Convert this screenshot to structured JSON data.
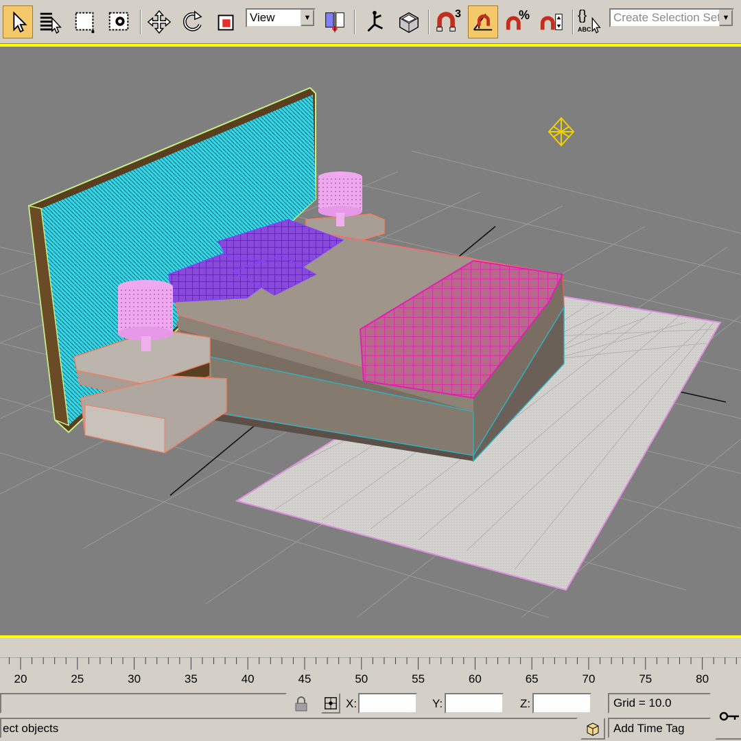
{
  "toolbar": {
    "tools": [
      {
        "name": "select-object-icon",
        "active": true
      },
      {
        "name": "select-by-name-icon",
        "active": false
      },
      {
        "name": "rectangular-selection-icon",
        "active": false
      },
      {
        "name": "window-crossing-icon",
        "active": false
      },
      {
        "name": "move-icon",
        "active": false
      },
      {
        "name": "rotate-icon",
        "active": false
      },
      {
        "name": "scale-icon",
        "active": false
      },
      {
        "name": "pivot-center-icon",
        "active": false
      },
      {
        "name": "select-and-manipulate-icon",
        "active": false
      },
      {
        "name": "keyboard-shortcut-override-icon",
        "active": false
      },
      {
        "name": "snaps-toggle-icon",
        "active": false
      },
      {
        "name": "angle-snap-icon",
        "active": true
      },
      {
        "name": "percent-snap-icon",
        "active": false
      },
      {
        "name": "spinner-snap-icon",
        "active": false
      },
      {
        "name": "edit-named-selections-icon",
        "active": false
      }
    ],
    "coord_system": "View",
    "snaps_label": "3",
    "percent_label": "%",
    "named_selection_placeholder": "Create Selection Set",
    "abc_label": "ABC",
    "braces_label": "{}"
  },
  "timeline": {
    "ticks": [
      "20",
      "25",
      "30",
      "35",
      "40",
      "45",
      "50",
      "55",
      "60",
      "65",
      "70",
      "75",
      "80"
    ]
  },
  "status": {
    "prompt": "ect objects",
    "x_label": "X:",
    "y_label": "Y:",
    "z_label": "Z:",
    "x_value": "",
    "y_value": "",
    "z_value": "",
    "grid": "Grid = 10.0",
    "add_time_tag": "Add Time Tag"
  },
  "colors": {
    "ui_bg": "#d4d0c8",
    "viewport_bg": "#7f7f7f",
    "active_viewport_border": "#ffff00",
    "active_tool": "#f5c86a"
  }
}
